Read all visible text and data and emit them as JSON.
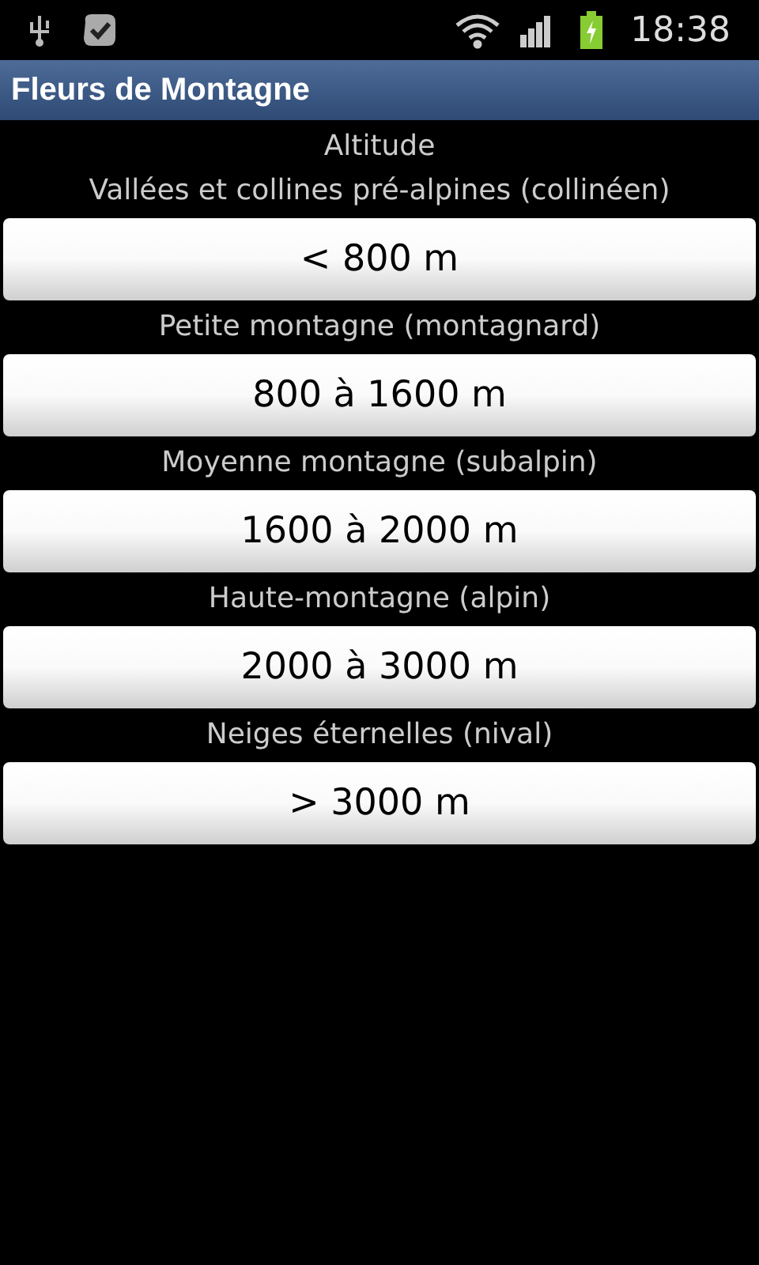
{
  "status_bar": {
    "time": "18:38"
  },
  "title_bar": {
    "title": "Fleurs de Montagne"
  },
  "heading": "Altitude",
  "ranges": [
    {
      "label": "Vallées et collines pré-alpines (collinéen)",
      "button": "< 800 m"
    },
    {
      "label": "Petite montagne (montagnard)",
      "button": "800 à 1600 m"
    },
    {
      "label": "Moyenne montagne (subalpin)",
      "button": "1600 à 2000 m"
    },
    {
      "label": "Haute-montagne (alpin)",
      "button": "2000 à 3000 m"
    },
    {
      "label": "Neiges éternelles (nival)",
      "button": "> 3000 m"
    }
  ]
}
